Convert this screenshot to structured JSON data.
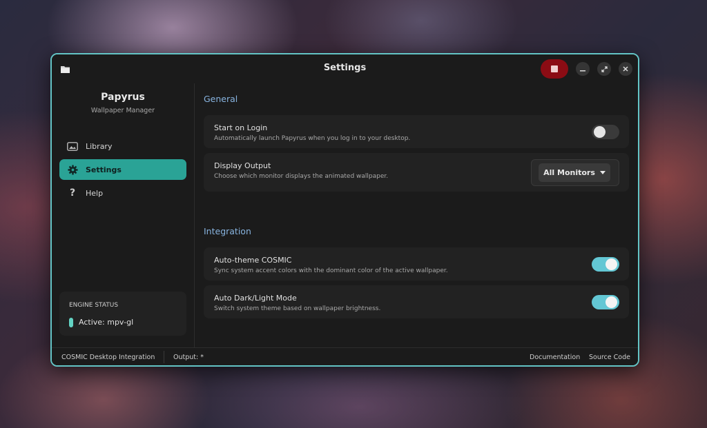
{
  "window": {
    "title": "Settings"
  },
  "sidebar": {
    "app_name": "Papyrus",
    "app_subtitle": "Wallpaper Manager",
    "items": [
      {
        "label": "Library",
        "icon": "image-icon",
        "active": false
      },
      {
        "label": "Settings",
        "icon": "gear-icon",
        "active": true
      },
      {
        "label": "Help",
        "icon": "question-icon",
        "active": false
      }
    ],
    "engine_status": {
      "label": "ENGINE STATUS",
      "value": "Active: mpv-gl"
    }
  },
  "general": {
    "title": "General",
    "start_on_login": {
      "title": "Start on Login",
      "desc": "Automatically launch Papyrus when you log in to your desktop.",
      "enabled": false
    },
    "display_output": {
      "title": "Display Output",
      "desc": "Choose which monitor displays the animated wallpaper.",
      "selected": "All Monitors"
    }
  },
  "integration": {
    "title": "Integration",
    "auto_theme": {
      "title": "Auto-theme COSMIC",
      "desc": "Sync system accent colors with the dominant color of the active wallpaper.",
      "enabled": true
    },
    "auto_dark_light": {
      "title": "Auto Dark/Light Mode",
      "desc": "Switch system theme based on wallpaper brightness.",
      "enabled": true
    }
  },
  "statusbar": {
    "left": "COSMIC Desktop Integration",
    "output": "Output: *",
    "documentation": "Documentation",
    "source_code": "Source Code"
  },
  "colors": {
    "accent": "#2aa396",
    "window_border": "#63c5c6",
    "toggle_on": "#63c7d4",
    "record": "#8b0c14",
    "section_title": "#88b4e0"
  }
}
